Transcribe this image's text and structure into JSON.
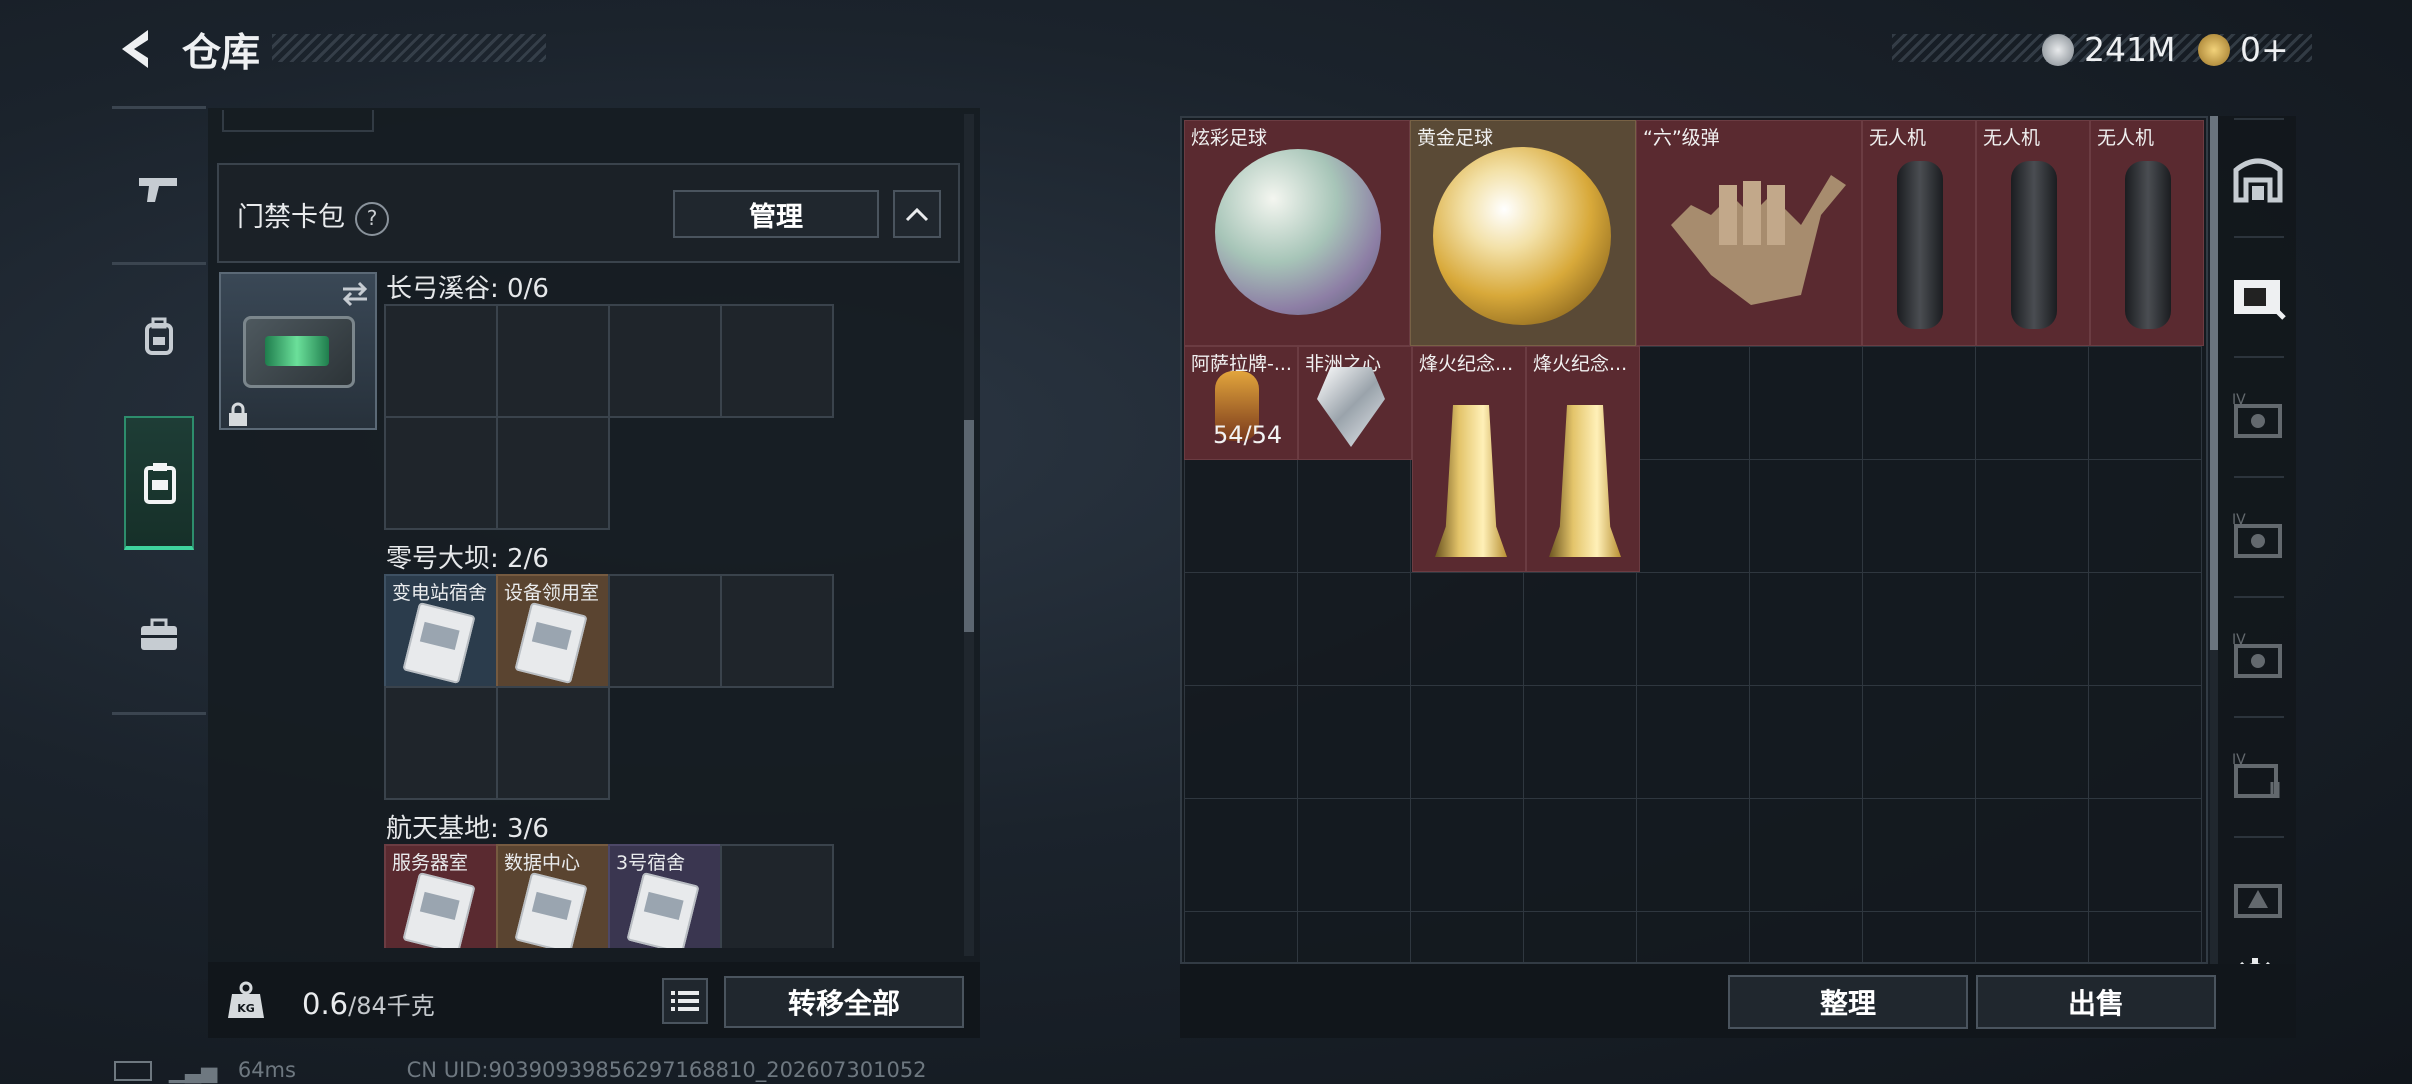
{
  "header": {
    "title": "仓库",
    "currency_1": "241M",
    "currency_2": "0+"
  },
  "nav": {
    "items": [
      "gun-icon",
      "backpack-icon",
      "keycard-case-icon",
      "toolbox-icon"
    ],
    "active": 2
  },
  "left_panel": {
    "card_pack_title": "门禁卡包",
    "manage_label": "管理",
    "sections": [
      {
        "title": "长弓溪谷: 0/6",
        "cards": []
      },
      {
        "title": "零号大坝: 2/6",
        "cards": [
          {
            "label": "变电站宿舍"
          },
          {
            "label": "设备领用室"
          }
        ]
      },
      {
        "title": "航天基地: 3/6",
        "cards": [
          {
            "label": "服务器室"
          },
          {
            "label": "数据中心"
          },
          {
            "label": "3号宿舍"
          }
        ]
      }
    ],
    "weight_current": "0.6",
    "weight_max": "/84千克",
    "transfer_all_label": "转移全部"
  },
  "right_panel": {
    "items": [
      {
        "label": "炫彩足球"
      },
      {
        "label": "黄金足球"
      },
      {
        "label": "“六”级弹"
      },
      {
        "label": "无人机"
      },
      {
        "label": "无人机"
      },
      {
        "label": "无人机"
      },
      {
        "label": "阿萨拉牌-...",
        "count": "54/54"
      },
      {
        "label": "非洲之心"
      },
      {
        "label": "烽火纪念..."
      },
      {
        "label": "烽火纪念..."
      }
    ],
    "sort_label": "整理",
    "sell_label": "出售"
  },
  "colors": {
    "accent_green": "#3fd39d",
    "item_red": "#5a2a30",
    "item_gold": "#5a4a36"
  },
  "status_bar": {
    "ping": "64ms",
    "uid": "CN UID:90390939856297168810_202607301052"
  }
}
